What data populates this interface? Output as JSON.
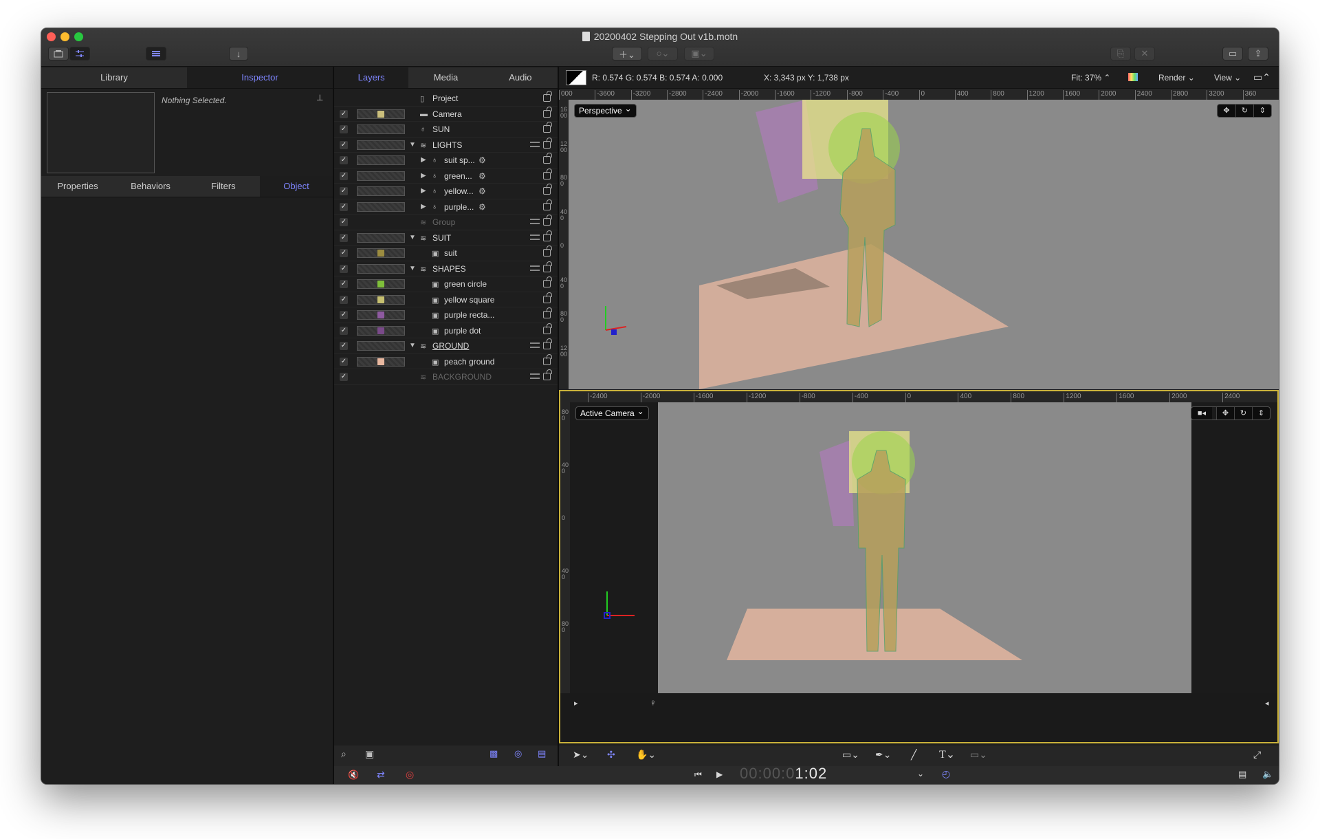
{
  "window": {
    "title": "20200402 Stepping Out v1b.motn"
  },
  "left_panel": {
    "tabs": [
      "Library",
      "Inspector"
    ],
    "active_tab": "Inspector",
    "status": "Nothing Selected.",
    "sub_tabs": [
      "Properties",
      "Behaviors",
      "Filters",
      "Object"
    ],
    "active_sub_tab": "Object"
  },
  "layers_panel": {
    "tabs": [
      "Layers",
      "Media",
      "Audio"
    ],
    "active_tab": "Layers",
    "rows": [
      {
        "name": "Project",
        "kind": "project",
        "indent": 0,
        "checked": false
      },
      {
        "name": "Camera",
        "kind": "camera",
        "indent": 0,
        "checked": true
      },
      {
        "name": "SUN",
        "kind": "light",
        "indent": 0,
        "checked": true
      },
      {
        "name": "LIGHTS",
        "kind": "group",
        "indent": 0,
        "checked": true,
        "expanded": true
      },
      {
        "name": "suit sp...",
        "kind": "light",
        "indent": 1,
        "checked": true
      },
      {
        "name": "green...",
        "kind": "light",
        "indent": 1,
        "checked": true
      },
      {
        "name": "yellow...",
        "kind": "light",
        "indent": 1,
        "checked": true
      },
      {
        "name": "purple...",
        "kind": "light",
        "indent": 1,
        "checked": true
      },
      {
        "name": "Group",
        "kind": "group-dim",
        "indent": 0,
        "checked": true
      },
      {
        "name": "SUIT",
        "kind": "group",
        "indent": 0,
        "checked": true,
        "expanded": true
      },
      {
        "name": "suit",
        "kind": "image",
        "indent": 1,
        "checked": true
      },
      {
        "name": "SHAPES",
        "kind": "group",
        "indent": 0,
        "checked": true,
        "expanded": true
      },
      {
        "name": "green circle",
        "kind": "image",
        "indent": 1,
        "checked": true
      },
      {
        "name": "yellow square",
        "kind": "image",
        "indent": 1,
        "checked": true
      },
      {
        "name": "purple recta...",
        "kind": "image",
        "indent": 1,
        "checked": true
      },
      {
        "name": "purple dot",
        "kind": "image",
        "indent": 1,
        "checked": true
      },
      {
        "name": "GROUND",
        "kind": "group",
        "indent": 0,
        "checked": true,
        "expanded": true
      },
      {
        "name": "peach ground",
        "kind": "image",
        "indent": 1,
        "checked": true
      },
      {
        "name": "BACKGROUND",
        "kind": "group-dim",
        "indent": 0,
        "checked": true
      }
    ]
  },
  "canvas_toolbar": {
    "pixel_readout": "R: 0.574  G: 0.574  B: 0.574  A: 0.000",
    "coords": "X:  3,343 px   Y:  1,738 px",
    "fit": "Fit: 37%",
    "render": "Render",
    "view": "View"
  },
  "top_viewport": {
    "label": "Perspective",
    "ruler_ticks": [
      "000",
      "-3600",
      "-3200",
      "-2800",
      "-2400",
      "-2000",
      "-1600",
      "-1200",
      "-800",
      "-400",
      "0",
      "400",
      "800",
      "1200",
      "1600",
      "2000",
      "2400",
      "2800",
      "3200",
      "360"
    ],
    "vertical_ticks": [
      "1600",
      "1200",
      "800",
      "400",
      "0",
      "400",
      "800",
      "1200"
    ]
  },
  "bottom_viewport": {
    "label": "Active Camera",
    "ruler_ticks": [
      "-2400",
      "-2000",
      "-1600",
      "-1200",
      "-800",
      "-400",
      "0",
      "400",
      "800",
      "1200",
      "1600",
      "2000",
      "2400"
    ],
    "vertical_ticks": [
      "800",
      "400",
      "0",
      "400",
      "800"
    ]
  },
  "transport": {
    "timecode_dim": "00:00:0",
    "timecode_lit": "1:02"
  },
  "colors": {
    "accent": "#7f86ff",
    "viewport_frame": "#c9b13a",
    "canvas": "#8a8a8a",
    "peach": "#e9b8a0",
    "yellow": "#f0ec8a",
    "green": "#9bd64a",
    "purple": "#b879c6"
  }
}
